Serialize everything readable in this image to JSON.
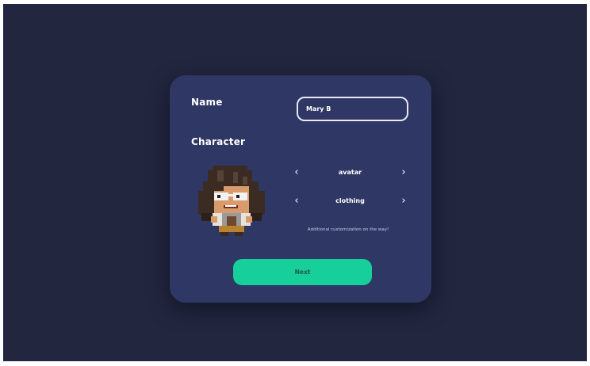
{
  "form": {
    "name_label": "Name",
    "name_value": "Mary B",
    "character_label": "Character",
    "avatar_option": "avatar",
    "clothing_option": "clothing",
    "prev_arrow": "‹",
    "next_arrow": "›",
    "customization_note": "Additional customization on the way!",
    "next_button": "Next"
  },
  "colors": {
    "background": "#22263f",
    "card": "#2f3765",
    "accent": "#17cf9b",
    "text": "#ffffff"
  },
  "icons": {
    "avatar_image": "pixel-art-character-avatar",
    "prev": "chevron-left-icon",
    "next": "chevron-right-icon"
  }
}
